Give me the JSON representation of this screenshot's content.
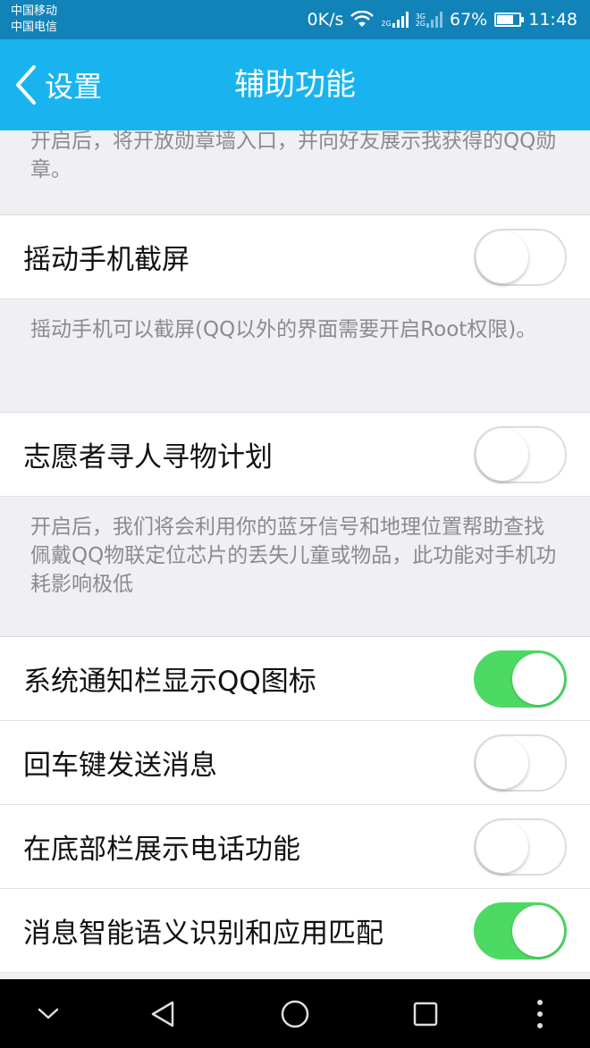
{
  "status_bar": {
    "carrier_1": "中国移动",
    "carrier_2": "中国电信",
    "speed": "0K/s",
    "net_tag_1": "2G",
    "net_tag_2_top": "3G",
    "net_tag_2_bottom": "2G",
    "battery": "67%",
    "time": "11:48"
  },
  "header": {
    "back_label": "设置",
    "title": "辅助功能",
    "background": "#19b4f0"
  },
  "sections": [
    {
      "type": "desc",
      "text": "开启后，将开放勋章墙入口，并向好友展示我获得的QQ勋章。"
    },
    {
      "type": "toggle",
      "label": "摇动手机截屏",
      "on": false
    },
    {
      "type": "desc",
      "text": "摇动手机可以截屏(QQ以外的界面需要开启Root权限)。"
    },
    {
      "type": "toggle",
      "label": "志愿者寻人寻物计划",
      "on": false
    },
    {
      "type": "desc",
      "text": "开启后，我们将会利用你的蓝牙信号和地理位置帮助查找佩戴QQ物联定位芯片的丢失儿童或物品，此功能对手机功耗影响极低"
    },
    {
      "type": "toggle",
      "label": "系统通知栏显示QQ图标",
      "on": true
    },
    {
      "type": "toggle",
      "label": "回车键发送消息",
      "on": false
    },
    {
      "type": "toggle",
      "label": "在底部栏展示电话功能",
      "on": false
    },
    {
      "type": "toggle",
      "label": "消息智能语义识别和应用匹配",
      "on": true
    }
  ],
  "colors": {
    "toggle_on": "#4cd964",
    "status_bar": "#1183b9"
  },
  "nav_bar": {
    "icons": [
      "chevron-down-icon",
      "back-triangle-icon",
      "home-circle-icon",
      "recents-square-icon",
      "more-dots-icon"
    ]
  }
}
